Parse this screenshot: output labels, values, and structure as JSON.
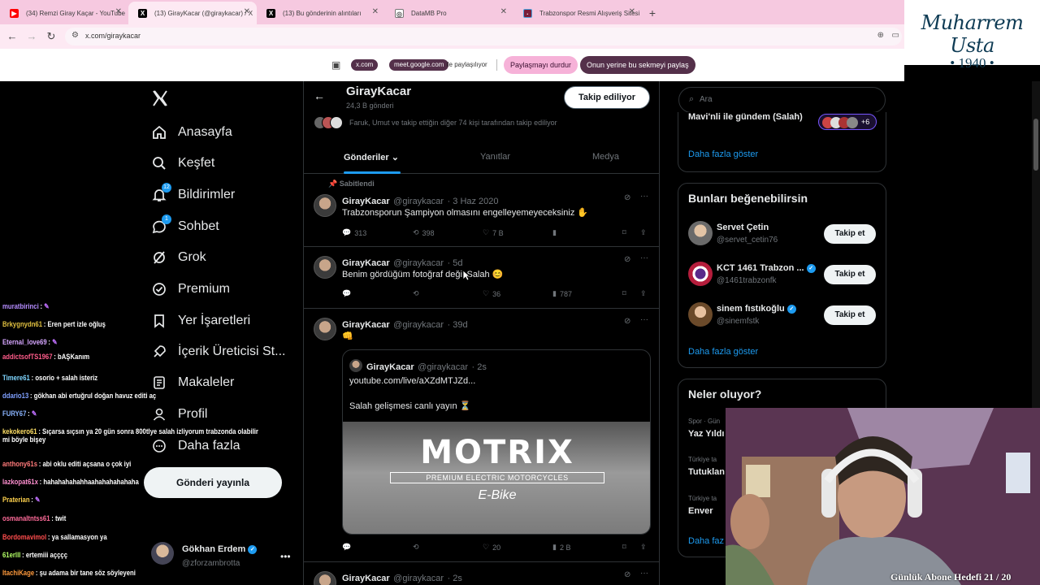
{
  "tabs": [
    {
      "label": "(34) Remzi Giray Kaçar - YouTube",
      "favicon": "youtube-icon",
      "active": false
    },
    {
      "label": "(13) GirayKacar (@giraykacar) / X",
      "favicon": "x-icon",
      "active": true
    },
    {
      "label": "(13) Bu gönderinin alıntıları",
      "favicon": "x-icon",
      "active": false
    },
    {
      "label": "DataMB Pro",
      "favicon": "globe-icon",
      "active": false
    },
    {
      "label": "Trabzonspor Resmi Alışveriş Sitesi",
      "favicon": "trabzonspor-icon",
      "active": false
    }
  ],
  "address": {
    "url": "x.com/giraykacar"
  },
  "logo": {
    "brand": "Muharrem Usta",
    "year": "• 1940 •"
  },
  "sharebar": {
    "chip1": "x.com",
    "chip2": "meet.google.com",
    "text": "ile paylaşılıyor",
    "stop": "Paylaşmayı durdur",
    "instead": "Onun yerine bu sekmeyi paylaş"
  },
  "nav": {
    "items": [
      {
        "label": "Anasayfa",
        "icon": "home-icon"
      },
      {
        "label": "Keşfet",
        "icon": "search-icon"
      },
      {
        "label": "Bildirimler",
        "icon": "bell-icon",
        "badge": "12"
      },
      {
        "label": "Sohbet",
        "icon": "chat-icon",
        "badge": "1"
      },
      {
        "label": "Grok",
        "icon": "grok-icon"
      },
      {
        "label": "Premium",
        "icon": "premium-icon"
      },
      {
        "label": "Yer İşaretleri",
        "icon": "bookmark-icon"
      },
      {
        "label": "İçerik Üreticisi St...",
        "icon": "rocket-icon"
      },
      {
        "label": "Makaleler",
        "icon": "article-icon"
      },
      {
        "label": "Profil",
        "icon": "person-icon"
      },
      {
        "label": "Daha fazla",
        "icon": "more-icon"
      }
    ],
    "post_button": "Gönderi yayınla",
    "account": {
      "name": "Gökhan Erdem",
      "handle": "@zforzambrotta"
    }
  },
  "chat": [
    {
      "user": "muratbirinci",
      "msg": "",
      "color": "#b58cff",
      "emote": true
    },
    {
      "user": "Brkygnydn61",
      "msg": "Eren pert izle oğluş",
      "color": "#e0c040"
    },
    {
      "user": "Eternal_love69",
      "msg": "",
      "color": "#d6a6ff",
      "emote": true
    },
    {
      "user": "addictsofTS1967",
      "msg": "bAŞKanım",
      "color": "#ff5c8a"
    },
    {
      "user": "Timere61",
      "msg": "osorio + salah isteriz",
      "color": "#7fd6ff"
    },
    {
      "user": "ddario13",
      "msg": "gökhan abi ertuğrul doğan havuz editi aç",
      "color": "#7fa0ff"
    },
    {
      "user": "FURY67",
      "msg": "",
      "color": "#8ab4ff",
      "emote": true
    },
    {
      "user": "kekokero61",
      "msg": "Sıçarsa sıçsın ya 20 gün sonra 800tlye salah izliyorum trabzonda olabilir mi böyle bişey",
      "color": "#ffe066"
    },
    {
      "user": "anthony61s",
      "msg": "abi oklu editi açsana o çok iyi",
      "color": "#ff7a7a"
    },
    {
      "user": "lazkopat61x",
      "msg": "hahahahahahhaahahahahahaha",
      "color": "#ff8fd0"
    },
    {
      "user": "Praterian",
      "msg": "",
      "color": "#ffd24d",
      "emote": true
    },
    {
      "user": "osmanaltntss61",
      "msg": "twit",
      "color": "#ff6b9a"
    },
    {
      "user": "Bordomavimol",
      "msg": "ya sallamasyon ya",
      "color": "#ff4d4d"
    },
    {
      "user": "61erlll",
      "msg": "ertemiii açççç",
      "color": "#b3ff66"
    },
    {
      "user": "ItachiKage",
      "msg": "şu adama bir tane söz söyleyeni",
      "color": "#ff9a3c"
    }
  ],
  "profile": {
    "name": "GirayKacar",
    "posts_count": "24,3 B gönderi",
    "follow_state": "Takip ediliyor",
    "followers_note": "Faruk, Umut ve takip ettiğin diğer 74 kişi tarafından takip ediliyor",
    "tabs": [
      "Gönderiler",
      "Yanıtlar",
      "Medya"
    ]
  },
  "tweets": [
    {
      "pinned": "Sabitlendi",
      "name": "GirayKacar",
      "handle": "@giraykacar",
      "time": "· 3 Haz 2020",
      "text": "Trabzonsporun Şampiyon olmasını engelleyemeyeceksiniz ✋",
      "replies": "313",
      "retweets": "398",
      "likes": "7 B",
      "views": ""
    },
    {
      "name": "GirayKacar",
      "handle": "@giraykacar",
      "time": "· 5d",
      "text": "Benim gördüğüm fotoğraf değil Salah 😊",
      "replies": "",
      "retweets": "",
      "likes": "36",
      "views": "787"
    },
    {
      "name": "GirayKacar",
      "handle": "@giraykacar",
      "time": "· 39d",
      "text": "👊",
      "quote": {
        "name": "GirayKacar",
        "handle": "@giraykacar",
        "time": "· 2s",
        "link": "youtube.com/live/aXZdMTJZd...",
        "text": "Salah gelişmesi canlı yayın ⏳",
        "image_title": "MOTRIX",
        "image_sub": "PREMIUM ELECTRIC MOTORCYCLES",
        "image_tag": "E-Bike"
      },
      "replies": "",
      "retweets": "",
      "likes": "20",
      "views": "2 B"
    },
    {
      "name": "GirayKacar",
      "handle": "@giraykacar",
      "time": "· 2s"
    }
  ],
  "right": {
    "search_placeholder": "Ara",
    "trend_top": "Mavi'nli ile gündem (Salah)",
    "avatars_more": "+6",
    "show_more": "Daha fazla göster",
    "suggest_title": "Bunları beğenebilirsin",
    "suggestions": [
      {
        "name": "Servet Çetin",
        "handle": "@servet_cetin76",
        "verified": false,
        "follow": "Takip et"
      },
      {
        "name": "KCT 1461 Trabzon ...",
        "handle": "@1461trabzonfk",
        "verified": true,
        "follow": "Takip et"
      },
      {
        "name": "sinem fıstıkoğlu",
        "handle": "@sinemfstk",
        "verified": true,
        "follow": "Takip et"
      }
    ],
    "suggest_more": "Daha fazla göster",
    "news_title": "Neler oluyor?",
    "news": [
      {
        "cat": "Spor · Gün",
        "title": "Yaz Yıldı"
      },
      {
        "cat": "Türkiye ta",
        "title": "Tutuklan"
      },
      {
        "cat": "Türkiye ta",
        "title": "Enver"
      }
    ],
    "news_more": "Daha faz"
  },
  "stream": {
    "caption": "Günlük Abone Hedefi 21 / 20"
  }
}
